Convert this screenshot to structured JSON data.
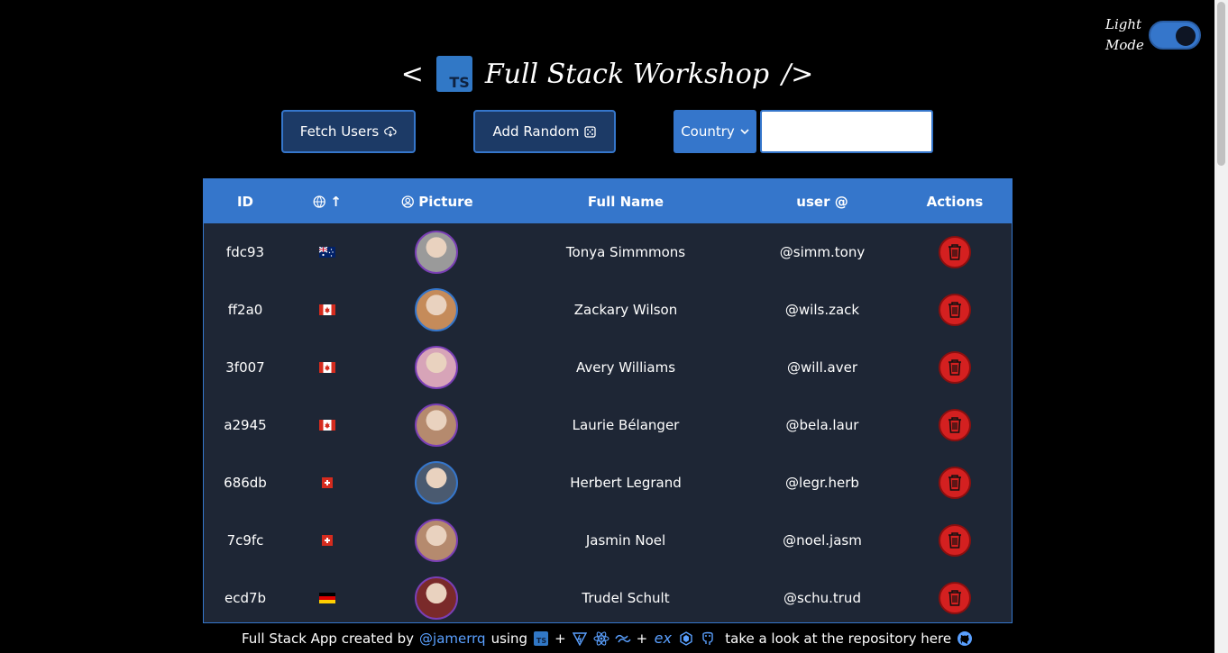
{
  "theme": {
    "label": "Light Mode",
    "accent": "#3576cb"
  },
  "header": {
    "left": "<",
    "logo": "TS",
    "title": "Full Stack Workshop",
    "right": "/>"
  },
  "toolbar": {
    "fetch_label": "Fetch Users",
    "fetch_icon": "cloud-download-icon",
    "random_label": "Add Random",
    "random_icon": "dice-icon",
    "country_select": "Country",
    "search_value": ""
  },
  "table": {
    "columns": {
      "id": "ID",
      "country_sort": "↑",
      "picture": "Picture",
      "fullname": "Full Name",
      "username": "user @",
      "actions": "Actions"
    },
    "rows": [
      {
        "id": "fdc93",
        "flag": "au",
        "name": "Tonya Simmmons",
        "user": "@simm.tony",
        "avatar_color": "#9a9a9a",
        "ring": "#7a3fb5"
      },
      {
        "id": "ff2a0",
        "flag": "ca",
        "name": "Zackary Wilson",
        "user": "@wils.zack",
        "avatar_color": "#c58b5a",
        "ring": "#3576cb"
      },
      {
        "id": "3f007",
        "flag": "ca",
        "name": "Avery Williams",
        "user": "@will.aver",
        "avatar_color": "#d7a4b8",
        "ring": "#7a3fb5"
      },
      {
        "id": "a2945",
        "flag": "ca",
        "name": "Laurie Bélanger",
        "user": "@bela.laur",
        "avatar_color": "#b58a6e",
        "ring": "#7a3fb5"
      },
      {
        "id": "686db",
        "flag": "ch",
        "name": "Herbert Legrand",
        "user": "@legr.herb",
        "avatar_color": "#4a5a70",
        "ring": "#3576cb"
      },
      {
        "id": "7c9fc",
        "flag": "ch",
        "name": "Jasmin Noel",
        "user": "@noel.jasm",
        "avatar_color": "#b58a6e",
        "ring": "#7a3fb5"
      },
      {
        "id": "ecd7b",
        "flag": "de",
        "name": "Trudel Schult",
        "user": "@schu.trud",
        "avatar_color": "#7a2a2a",
        "ring": "#7a3fb5"
      }
    ]
  },
  "footer": {
    "prefix": "Full Stack App created by",
    "author": "@jamerrq",
    "using": "using",
    "plus": "+",
    "express": "ex",
    "suffix": "take a look at the repository here"
  }
}
